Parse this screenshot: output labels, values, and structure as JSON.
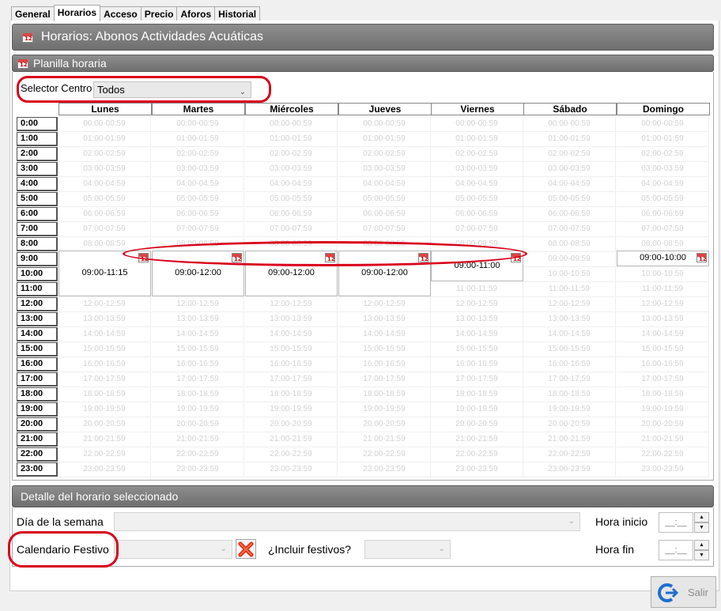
{
  "tabs": [
    "General",
    "Horarios",
    "Acceso",
    "Precio",
    "Aforos",
    "Historial"
  ],
  "active_tab": "Horarios",
  "main_title": "Horarios: Abonos Actividades Acuáticas",
  "planilla_title": "Planilla horaria",
  "selector": {
    "label": "Selector Centro",
    "value": "Todos"
  },
  "days": [
    "Lunes",
    "Martes",
    "Miércoles",
    "Jueves",
    "Viernes",
    "Sábado",
    "Domingo"
  ],
  "hours": [
    "0:00",
    "1:00",
    "2:00",
    "3:00",
    "4:00",
    "5:00",
    "6:00",
    "7:00",
    "8:00",
    "9:00",
    "10:00",
    "11:00",
    "12:00",
    "13:00",
    "14:00",
    "15:00",
    "16:00",
    "17:00",
    "18:00",
    "19:00",
    "20:00",
    "21:00",
    "22:00",
    "23:00"
  ],
  "slots": [
    "00:00-00:59",
    "01:00-01:59",
    "02:00-02:59",
    "03:00-03:59",
    "04:00-04:59",
    "05:00-05:59",
    "06:00-06:59",
    "07:00-07:59",
    "08:00-08:59",
    "09:00-09:59",
    "10:00-10:59",
    "11:00-11:59",
    "12:00-12:59",
    "13:00-13:59",
    "14:00-14:59",
    "15:00-15:59",
    "16:00-16:59",
    "17:00-17:59",
    "18:00-18:59",
    "19:00-19:59",
    "20:00-20:59",
    "21:00-21:59",
    "22:00-22:59",
    "23:00-23:59"
  ],
  "events": [
    {
      "day": "Lunes",
      "text": "09:00-11:15"
    },
    {
      "day": "Martes",
      "text": "09:00-12:00"
    },
    {
      "day": "Miércoles",
      "text": "09:00-12:00"
    },
    {
      "day": "Jueves",
      "text": "09:00-12:00"
    },
    {
      "day": "Viernes",
      "text": "09:00-11:00"
    },
    {
      "day": "Domingo",
      "text": "09:00-10:00"
    }
  ],
  "detail": {
    "title": "Detalle del horario seleccionado",
    "dia_label": "Día de la semana",
    "calendario_label": "Calendario Festivo",
    "incluir_label": "¿Incluir festivos?",
    "hora_inicio_label": "Hora inicio",
    "hora_fin_label": "Hora fin",
    "hora_inicio_value": "__:__",
    "hora_fin_value": "__:__"
  },
  "salir_label": "Salir"
}
